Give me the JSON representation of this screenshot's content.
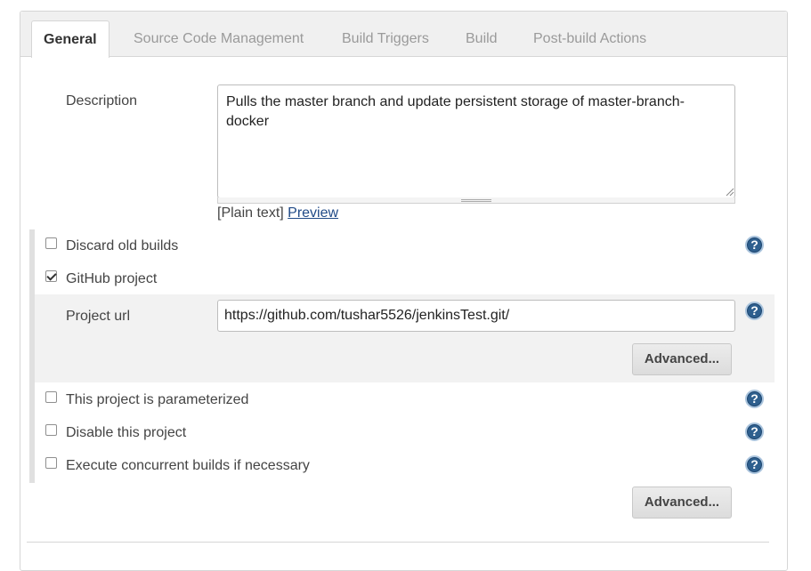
{
  "tabs": [
    {
      "label": "General",
      "active": true
    },
    {
      "label": "Source Code Management"
    },
    {
      "label": "Build Triggers"
    },
    {
      "label": "Build"
    },
    {
      "label": "Post-build Actions"
    }
  ],
  "description": {
    "label": "Description",
    "value": "Pulls the master branch and update persistent storage of master-branch-docker",
    "format_text": "[Plain text]",
    "preview_link": "Preview"
  },
  "options": {
    "discard_old_builds": {
      "label": "Discard old builds",
      "checked": false
    },
    "github_project": {
      "label": "GitHub project",
      "checked": true
    },
    "parameterized": {
      "label": "This project is parameterized",
      "checked": false
    },
    "disable_project": {
      "label": "Disable this project",
      "checked": false
    },
    "concurrent_builds": {
      "label": "Execute concurrent builds if necessary",
      "checked": false
    }
  },
  "github": {
    "project_url_label": "Project url",
    "project_url_value": "https://github.com/tushar5526/jenkinsTest.git/",
    "advanced_button": "Advanced..."
  },
  "general": {
    "advanced_button": "Advanced..."
  },
  "icons": {
    "help": "help-icon",
    "help_glyph": "?"
  },
  "colors": {
    "help_icon": "#2e5f8e",
    "link": "#204a87",
    "tab_inactive": "#9a9a9a"
  }
}
